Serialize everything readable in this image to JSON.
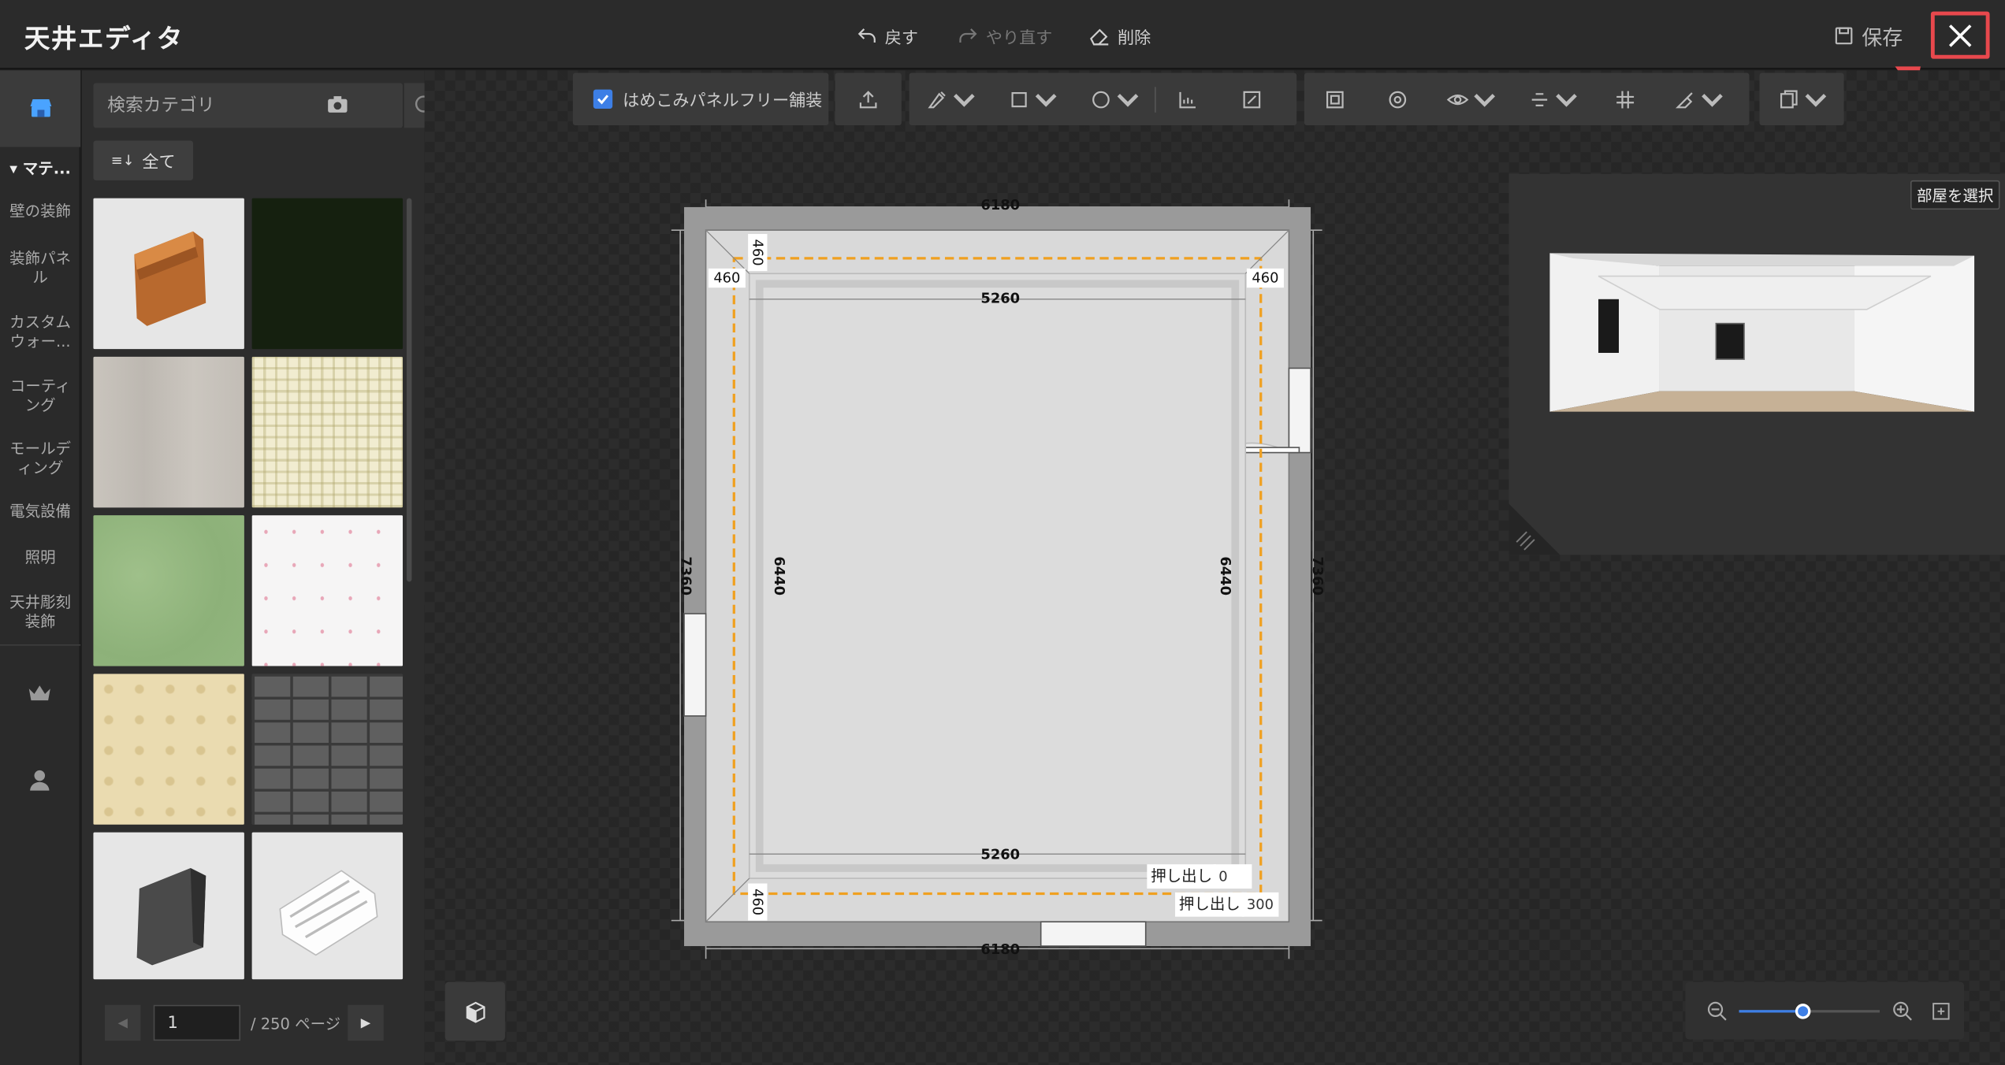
{
  "header": {
    "title": "天井エディタ",
    "undo_label": "戻す",
    "redo_label": "やり直す",
    "delete_label": "削除",
    "save_label": "保存"
  },
  "rail": {
    "material_label": "マテ...",
    "categories": [
      "壁の装飾",
      "装飾パネル",
      "カスタムウォー...",
      "コーティング",
      "モールディング",
      "電気設備",
      "照明",
      "天井彫刻装飾"
    ]
  },
  "catalog": {
    "search_placeholder": "検索カテゴリ",
    "all_label": "全て",
    "current_page": "1",
    "total_pages_label": "/ 250 ページ"
  },
  "toolbar": {
    "seamless_label": "はめこみパネルフリー舗装",
    "seamless_checked": true
  },
  "preview": {
    "room_select_label": "部屋を選択"
  },
  "plan": {
    "outer_width": "6180",
    "outer_height": "7360",
    "inner_width": "5260",
    "inner_height": "6440",
    "offset": "460",
    "extrude_label": "押し出し",
    "extrude_inner_value": "0",
    "extrude_outer_value": "300"
  },
  "zoom": {
    "level": 0.45
  },
  "colors": {
    "accent": "#3d7fe6",
    "close_highlight": "#e8484d",
    "dashed_outline": "#f0a020"
  }
}
